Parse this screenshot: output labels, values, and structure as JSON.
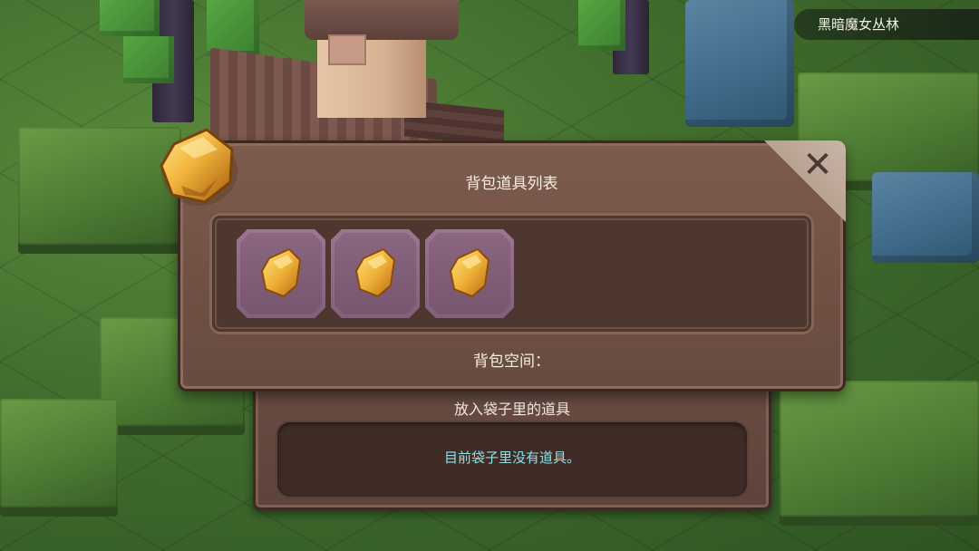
{
  "location": {
    "name": "黑暗魔女丛林"
  },
  "main_panel": {
    "title": "背包道具列表",
    "space_label": "背包空间：",
    "items": [
      {
        "icon": "gold-nugget-icon"
      },
      {
        "icon": "gold-nugget-icon"
      },
      {
        "icon": "gold-nugget-icon"
      }
    ],
    "close_glyph": "✕"
  },
  "bag_panel": {
    "title": "放入袋子里的道具",
    "empty_message": "目前袋子里没有道具。"
  },
  "colors": {
    "panel_brown": "#7c5c4d",
    "slot_purple": "#9c7590",
    "gold": "#f0b23a",
    "empty_text": "#8fe0e8"
  }
}
